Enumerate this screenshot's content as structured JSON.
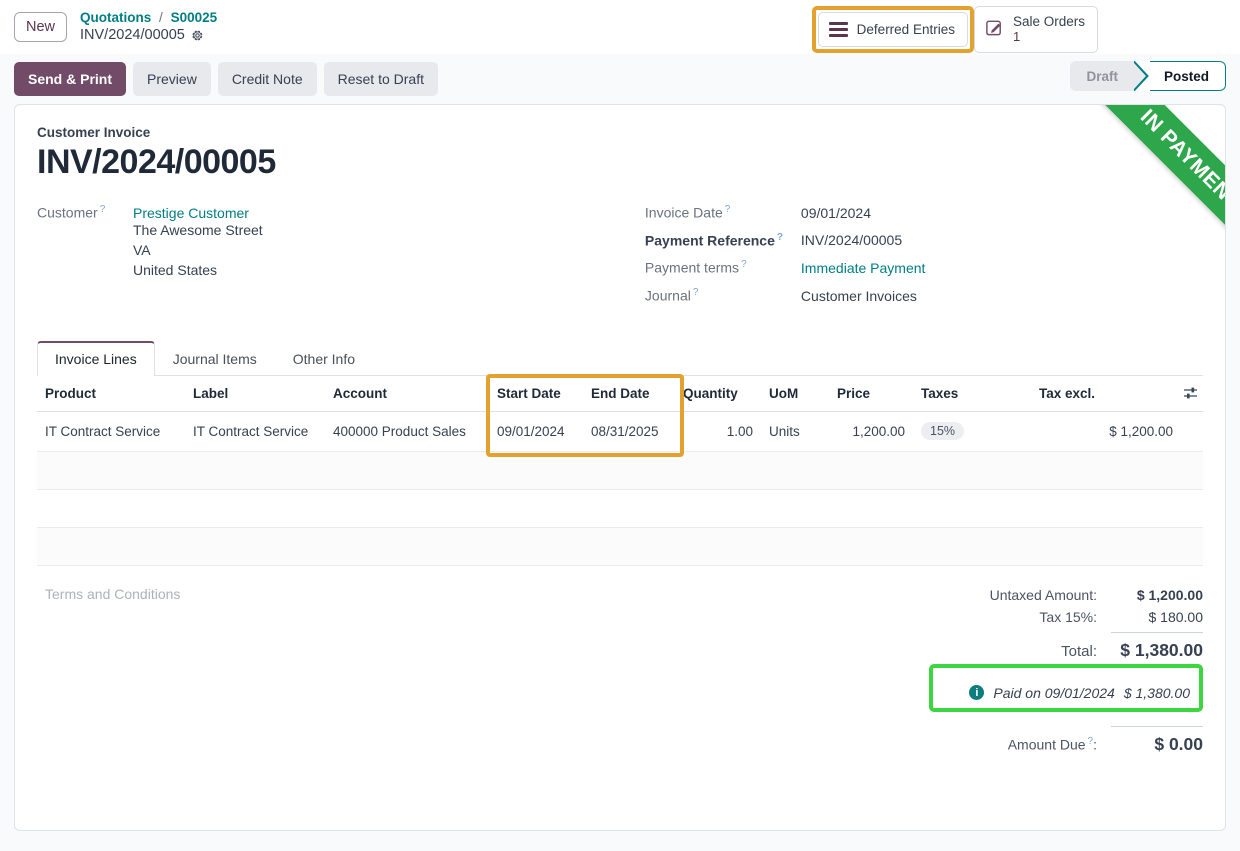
{
  "control_panel": {
    "new_button": "New",
    "breadcrumb": {
      "parent": "Quotations",
      "separator": "/",
      "parent_record": "S00025",
      "current": "INV/2024/00005",
      "settings_icon": "gear-icon"
    },
    "stat_buttons": [
      {
        "label": "Deferred Entries",
        "value": "",
        "icon": "lines-icon",
        "highlighted": true
      },
      {
        "label": "Sale Orders",
        "value": "1",
        "icon": "edit-square-icon",
        "highlighted": false
      }
    ]
  },
  "action_bar": {
    "buttons": [
      {
        "label": "Send & Print",
        "style": "primary"
      },
      {
        "label": "Preview",
        "style": "secondary"
      },
      {
        "label": "Credit Note",
        "style": "secondary"
      },
      {
        "label": "Reset to Draft",
        "style": "secondary"
      }
    ],
    "statuses": [
      {
        "label": "Draft",
        "active": false
      },
      {
        "label": "Posted",
        "active": true
      }
    ]
  },
  "ribbon": {
    "text": "IN PAYMENT",
    "color": "#2ea64b"
  },
  "record": {
    "doc_type": "Customer Invoice",
    "title": "INV/2024/00005",
    "customer_label": "Customer",
    "customer_name": "Prestige Customer",
    "address": [
      "The Awesome Street",
      "VA",
      "United States"
    ],
    "fields_right": [
      {
        "label": "Invoice Date",
        "value": "09/01/2024",
        "bold_label": false,
        "link": false
      },
      {
        "label": "Payment Reference",
        "value": "INV/2024/00005",
        "bold_label": true,
        "link": false
      },
      {
        "label": "Payment terms",
        "value": "Immediate Payment",
        "bold_label": false,
        "link": true
      },
      {
        "label": "Journal",
        "value": "Customer Invoices",
        "bold_label": false,
        "link": false
      }
    ]
  },
  "tabs": [
    {
      "label": "Invoice Lines",
      "active": true
    },
    {
      "label": "Journal Items",
      "active": false
    },
    {
      "label": "Other Info",
      "active": false
    }
  ],
  "lines_table": {
    "columns": [
      {
        "label": "Product",
        "align": "left"
      },
      {
        "label": "Label",
        "align": "left"
      },
      {
        "label": "Account",
        "align": "left"
      },
      {
        "label": "Start Date",
        "align": "left",
        "highlighted": true
      },
      {
        "label": "End Date",
        "align": "left",
        "highlighted": true
      },
      {
        "label": "Quantity",
        "align": "right"
      },
      {
        "label": "UoM",
        "align": "left"
      },
      {
        "label": "Price",
        "align": "right"
      },
      {
        "label": "Taxes",
        "align": "left"
      },
      {
        "label": "Tax excl.",
        "align": "right"
      }
    ],
    "optional_columns_icon": "sliders-icon",
    "rows": [
      {
        "product": "IT Contract Service",
        "label": "IT Contract Service",
        "account": "400000 Product Sales",
        "start_date": "09/01/2024",
        "end_date": "08/31/2025",
        "quantity": "1.00",
        "uom": "Units",
        "price": "1,200.00",
        "taxes": "15%",
        "tax_excl": "$ 1,200.00"
      }
    ],
    "empty_rows": 3
  },
  "footer": {
    "terms_placeholder": "Terms and Conditions",
    "totals": [
      {
        "label": "Untaxed Amount:",
        "value": "$ 1,200.00",
        "bold": true
      },
      {
        "label": "Tax 15%:",
        "value": "$ 180.00",
        "bold": false
      }
    ],
    "total": {
      "label": "Total:",
      "value": "$ 1,380.00"
    },
    "payment": {
      "icon": "info-icon",
      "text": "Paid on 09/01/2024",
      "amount": "$ 1,380.00",
      "highlighted": true
    },
    "amount_due": {
      "label": "Amount Due",
      "suffix": ":",
      "value": "$ 0.00"
    }
  },
  "colors": {
    "primary": "#714b67",
    "link": "#017e84",
    "highlight_orange": "#e2a22d",
    "highlight_green": "#3ed63e",
    "ribbon_green": "#2ea64b"
  }
}
